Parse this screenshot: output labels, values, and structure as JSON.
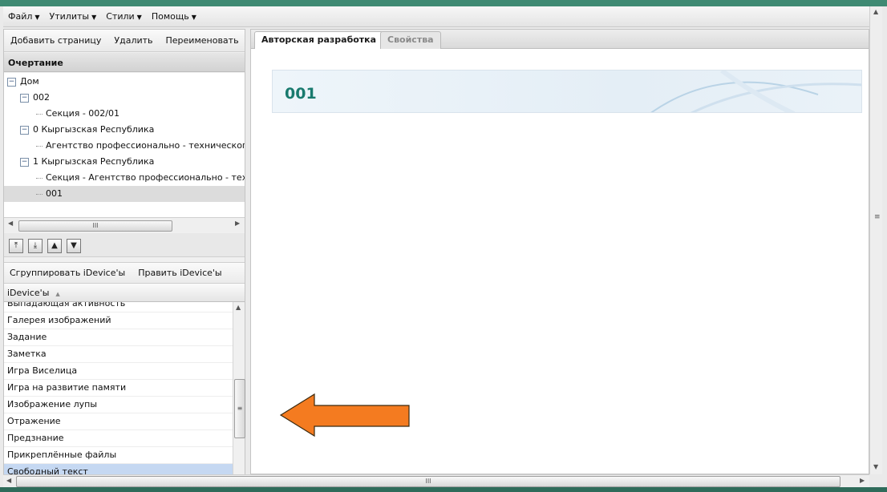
{
  "menu": [
    {
      "label": "Файл"
    },
    {
      "label": "Утилиты"
    },
    {
      "label": "Стили"
    },
    {
      "label": "Помощь"
    }
  ],
  "page_toolbar": {
    "add_page": "Добавить страницу",
    "delete": "Удалить",
    "rename": "Переименовать"
  },
  "outline": {
    "title": "Очертание",
    "nodes": [
      {
        "label": "Дом",
        "expander": "−"
      },
      {
        "label": "002",
        "expander": "−"
      },
      {
        "label": "Секция - 002/01"
      },
      {
        "label": "0 Кыргызская Республика",
        "expander": "−"
      },
      {
        "label": "Агентство профессионально - технического образования"
      },
      {
        "label": "1 Кыргызская Республика",
        "expander": "−"
      },
      {
        "label": "Секция - Агентство профессионально - технического образования"
      },
      {
        "label": "001",
        "selected": true
      }
    ]
  },
  "idevice_toolbar": {
    "group": "Сгруппировать iDevice'ы",
    "edit": "Править iDevice'ы"
  },
  "idevices": {
    "header": "iDevice'ы",
    "items": [
      "Выпадающая активность",
      "Галерея изображений",
      "Задание",
      "Заметка",
      "Игра Виселица",
      "Игра на развитие памяти",
      "Изображение лупы",
      "Отражение",
      "Предзнание",
      "Прикреплённые файлы",
      "Свободный текст"
    ],
    "selected_index": 10
  },
  "tabs": [
    {
      "label": "Авторская разработка",
      "active": true
    },
    {
      "label": "Свойства",
      "active": false
    }
  ],
  "content": {
    "page_title": "001"
  },
  "colors": {
    "accent_title": "#197a6e",
    "arrow_fill": "#f47b20",
    "selection": "#c5d8f2"
  }
}
